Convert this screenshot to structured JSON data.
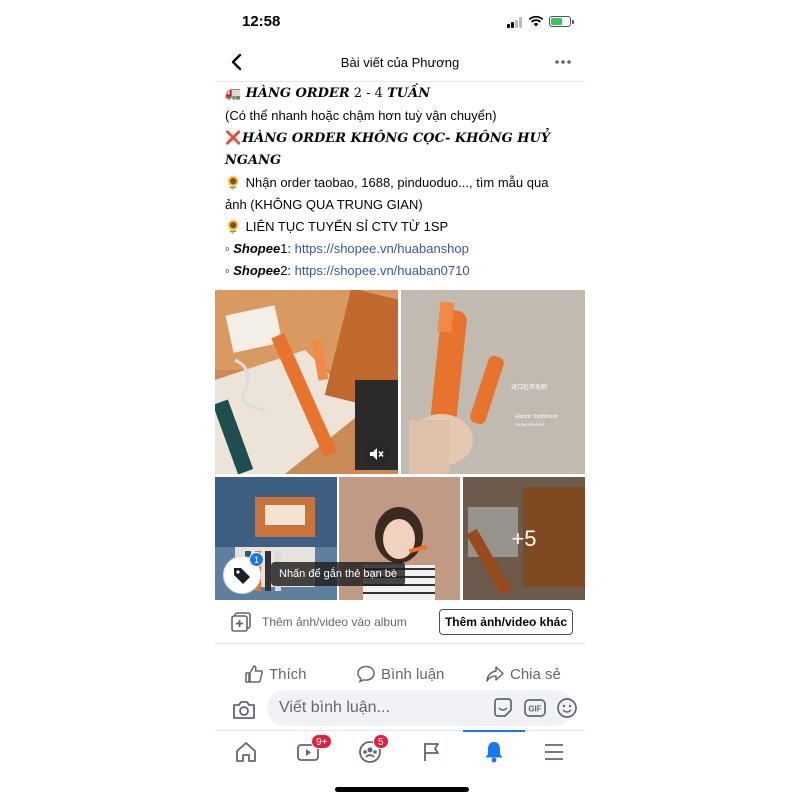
{
  "status_bar": {
    "time": "12:58"
  },
  "header": {
    "title": "Bài viết của Phương"
  },
  "post": {
    "line1_emoji": "🚛",
    "line1_bold": "HÀNG ORDER",
    "line1_rest": " 2 - 4 ",
    "line1_bold2": "TUẦN",
    "line2": "(Có thể nhanh hoặc chậm hơn tuỳ vận chuyển)",
    "line3_emoji": "❌",
    "line3a": "HÀNG ORDER KHÔNG CỌC- KHÔNG HUỶ",
    "line3b": "NGANG",
    "line4_emoji": "🌻",
    "line4a": "Nhận order taobao, 1688, pinduoduo..., tìm mẫu qua",
    "line4b": "ảnh (KHÔNG QUA TRUNG GIAN)",
    "line5_emoji": "🌻",
    "line5": "LIÊN TỤC TUYỂN SỈ CTV TỪ 1SP",
    "shop1_bullet": "◦",
    "shop1_label": "Shopee",
    "shop1_num": "1: ",
    "shop1_url": "https://shopee.vn/huabanshop",
    "shop2_bullet": "◦",
    "shop2_label": "Shopee",
    "shop2_num": "2: ",
    "shop2_url": "https://shopee.vn/huaban0710"
  },
  "photos": {
    "photo2_caption_cn": "进口牡邦毛刷",
    "photo2_caption_en1": "Electric Toothbrush",
    "photo2_caption_en2": "FROM FRANCE",
    "more_count": "+5",
    "tag_badge": "1",
    "tag_tooltip": "Nhấn để gắn thẻ bạn bè"
  },
  "album": {
    "add_label": "Thêm ảnh/video vào album",
    "more_button": "Thêm ảnh/video khác"
  },
  "actions": {
    "like": "Thích",
    "comment": "Bình luận",
    "share": "Chia sẻ"
  },
  "comment_box": {
    "placeholder": "Viết bình luận..."
  },
  "tabbar": {
    "video_badge": "9+",
    "groups_badge": "5"
  },
  "colors": {
    "accent": "#1877f2",
    "link": "#385898",
    "badge": "#e41e3f",
    "orange": "#e8732c"
  }
}
